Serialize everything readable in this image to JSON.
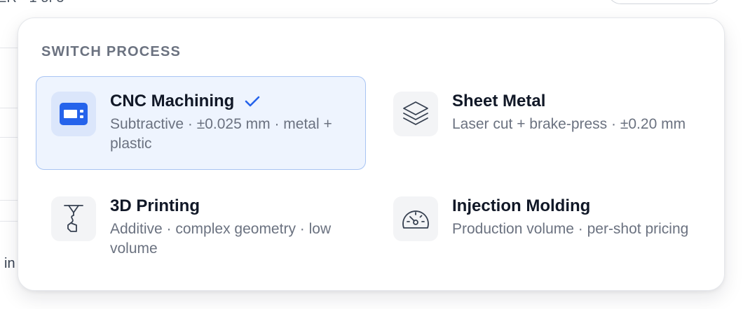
{
  "background": {
    "top_text": "ER · 1 of 5",
    "bottom_text": "in"
  },
  "popover": {
    "title": "SWITCH PROCESS",
    "options": [
      {
        "name": "CNC Machining",
        "description": "Subtractive · ±0.025 mm · metal + plastic",
        "icon": "cnc-machine-icon",
        "selected": true
      },
      {
        "name": "Sheet Metal",
        "description": "Laser cut + brake-press · ±0.20 mm",
        "icon": "layers-icon",
        "selected": false
      },
      {
        "name": "3D Printing",
        "description": "Additive · complex geometry · low volume",
        "icon": "printer-nozzle-icon",
        "selected": false
      },
      {
        "name": "Injection Molding",
        "description": "Production volume · per-shot pricing",
        "icon": "gauge-icon",
        "selected": false
      }
    ]
  },
  "colors": {
    "accent": "#2563eb",
    "selected_bg": "#eef4fe",
    "selected_border": "#a8c4f3",
    "title_text": "#111827",
    "muted_text": "#6b7280"
  }
}
